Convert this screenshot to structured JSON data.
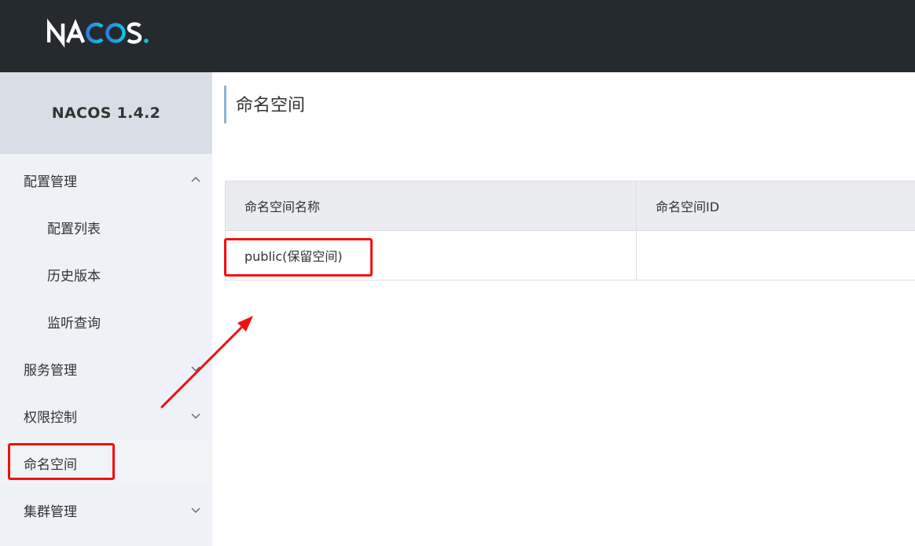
{
  "header": {
    "logo_text": "NACOS."
  },
  "sidebar": {
    "version": "NACOS 1.4.2",
    "items": [
      {
        "label": "配置管理",
        "level": "top",
        "arrow": "chevron-up-icon"
      },
      {
        "label": "配置列表",
        "level": "sub"
      },
      {
        "label": "历史版本",
        "level": "sub"
      },
      {
        "label": "监听查询",
        "level": "sub"
      },
      {
        "label": "服务管理",
        "level": "top",
        "arrow": "chevron-down-icon"
      },
      {
        "label": "权限控制",
        "level": "top",
        "arrow": "chevron-down-icon"
      },
      {
        "label": "命名空间",
        "level": "top",
        "active": true
      },
      {
        "label": "集群管理",
        "level": "top",
        "arrow": "chevron-down-icon"
      }
    ]
  },
  "main": {
    "title": "命名空间",
    "table": {
      "columns": [
        "命名空间名称",
        "命名空间ID"
      ],
      "rows": [
        [
          "public(保留空间)",
          ""
        ]
      ]
    }
  },
  "colors": {
    "header_bg": "#252a2f",
    "sidebar_bg": "#eef1f5",
    "annotation_red": "#f40f0f",
    "logo_accent": "#11c4e0"
  }
}
